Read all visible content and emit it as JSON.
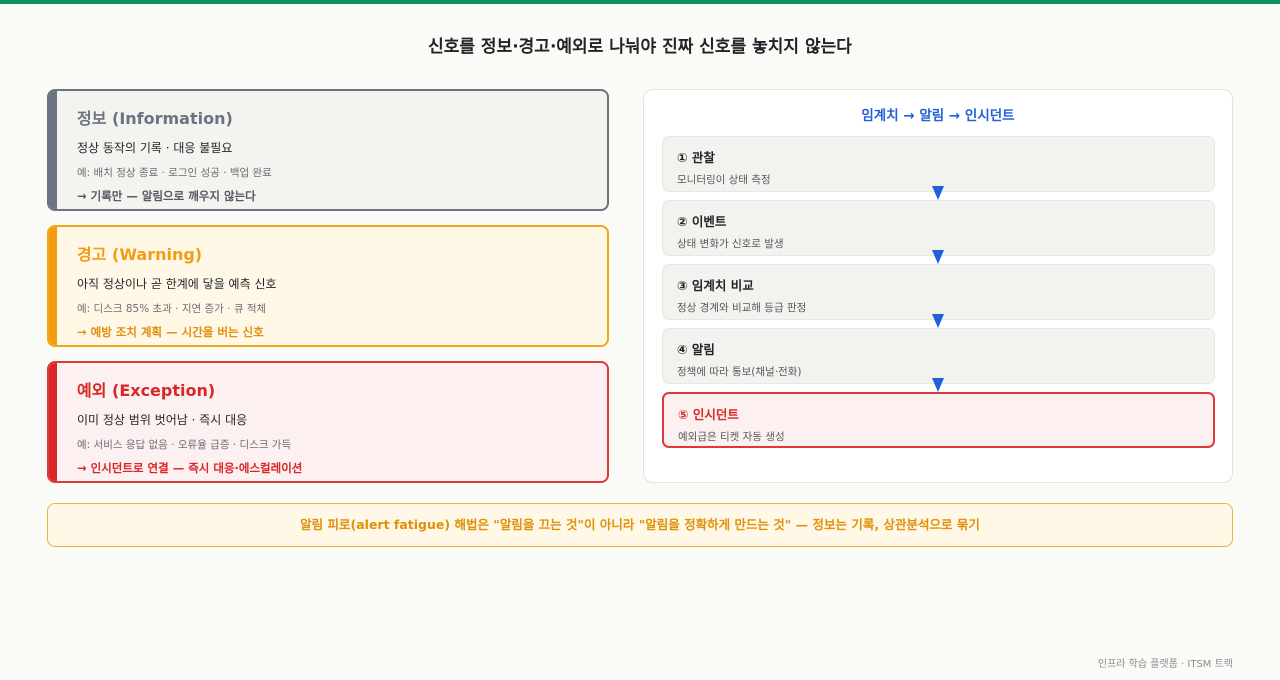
{
  "title": "신호를 정보·경고·예외로 나눠야 진짜 신호를 놓치지 않는다",
  "cards": [
    {
      "title": "정보 (Information)",
      "desc": "정상 동작의 기록 · 대응 불필요",
      "example": "예: 배치 정상 종료 · 로그인 성공 · 백업 완료",
      "action": "→ 기록만 — 알림으로 깨우지 않는다"
    },
    {
      "title": "경고 (Warning)",
      "desc": "아직 정상이나 곧 한계에 닿을 예측 신호",
      "example": "예: 디스크 85% 초과 · 지연 증가 · 큐 적체",
      "action": "→ 예방 조치 계획 — 시간을 버는 신호"
    },
    {
      "title": "예외 (Exception)",
      "desc": "이미 정상 범위 벗어남 · 즉시 대응",
      "example": "예: 서비스 응답 없음 · 오류율 급증 · 디스크 가득",
      "action": "→ 인시던트로 연결 — 즉시 대응·에스컬레이션"
    }
  ],
  "flow": {
    "title": "임계치 → 알림 → 인시던트",
    "steps": [
      {
        "title": "① 관찰",
        "desc": "모니터링이 상태 측정"
      },
      {
        "title": "② 이벤트",
        "desc": "상태 변화가 신호로 발생"
      },
      {
        "title": "③ 임계치 비교",
        "desc": "정상 경계와 비교해 등급 판정"
      },
      {
        "title": "④ 알림",
        "desc": "정책에 따라 통보(채널·전화)"
      },
      {
        "title": "⑤ 인시던트",
        "desc": "예외급은 티켓 자동 생성"
      }
    ]
  },
  "banner": "알림 피로(alert fatigue) 해법은 \"알림을 끄는 것\"이 아니라 \"알림을 정확하게 만드는 것\" — 정보는 기록, 상관분석으로 묶기",
  "footer": "인프라 학습 플랫폼 · ITSM 트랙",
  "colors": {
    "accent_green": "#0a9466",
    "info": "#6b7280",
    "warning": "#f39c12",
    "exception": "#d92626",
    "flow_blue": "#2060d8"
  }
}
